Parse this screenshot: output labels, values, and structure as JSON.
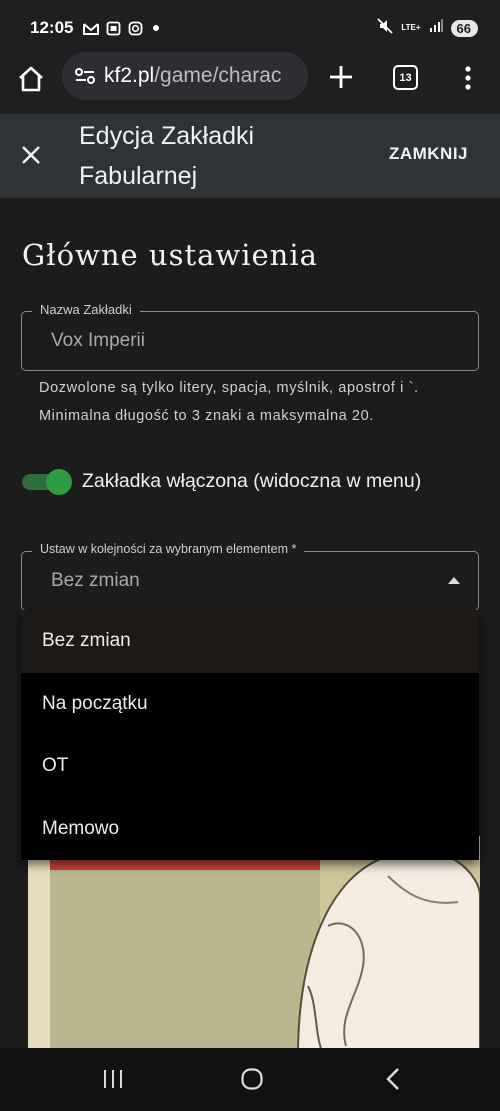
{
  "status_bar": {
    "time": "12:05",
    "network": "LTE+",
    "battery": "66",
    "icons_left": [
      "gmail-icon",
      "screenshot-icon",
      "instagram-icon",
      "notification-dot"
    ],
    "icons_right": [
      "mute-icon",
      "lte-icon",
      "signal-icon",
      "battery-icon"
    ]
  },
  "browser": {
    "url_host": "kf2.pl",
    "url_path": "/game/charac",
    "tab_count": "13"
  },
  "dialog": {
    "title": "Edycja Zakładki Fabularnej",
    "close_label": "ZAMKNIJ"
  },
  "main": {
    "section_title": "Główne ustawienia",
    "name_field": {
      "label": "Nazwa Zakładki",
      "value": "Vox Imperii"
    },
    "helper_text": "Dozwolone są tylko litery, spacja, myślnik, apostrof i `. Minimalna długość to 3 znaki a maksymalna 20.",
    "toggle": {
      "label": "Zakładka włączona (widoczna w menu)",
      "checked": true
    },
    "order_field": {
      "label": "Ustaw w kolejności za wybranym elementem *",
      "value": "Bez zmian"
    },
    "order_options": [
      {
        "label": "Bez zmian",
        "selected": true
      },
      {
        "label": "Na początku",
        "selected": false
      },
      {
        "label": "OT",
        "selected": false
      },
      {
        "label": "Memowo",
        "selected": false
      }
    ]
  },
  "colors": {
    "header_bg": "#2e3338",
    "page_bg": "#1c1c1c",
    "toggle_accent": "#2e9d41",
    "menu_bg": "#000000"
  }
}
